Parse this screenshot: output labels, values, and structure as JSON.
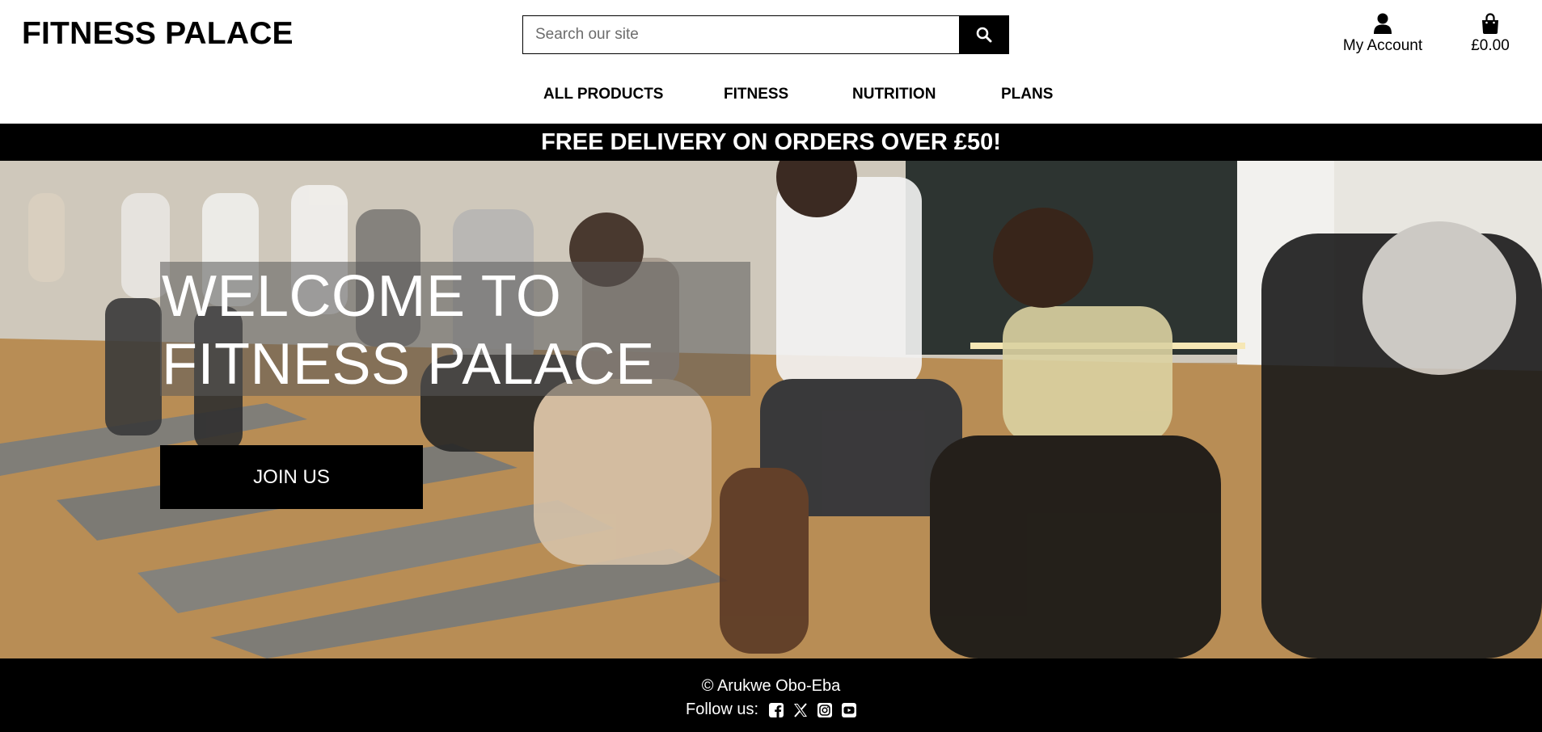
{
  "header": {
    "logo": "FITNESS PALACE",
    "search": {
      "placeholder": "Search our site",
      "button_icon": "search-icon"
    },
    "account": {
      "label": "My Account",
      "icon": "user-icon"
    },
    "bag": {
      "total": "£0.00",
      "icon": "shopping-bag-icon"
    }
  },
  "nav": {
    "items": [
      {
        "label": "ALL PRODUCTS"
      },
      {
        "label": "FITNESS"
      },
      {
        "label": "NUTRITION"
      },
      {
        "label": "PLANS"
      }
    ]
  },
  "banner": {
    "text": "FREE DELIVERY ON ORDERS OVER £50!"
  },
  "hero": {
    "title": "WELCOME TO FITNESS PALACE",
    "button_label": "JOIN US"
  },
  "footer": {
    "copyright": "© Arukwe Obo-Eba",
    "follow_label": "Follow us:",
    "social_icons": [
      "facebook-icon",
      "x-icon",
      "instagram-icon",
      "youtube-icon"
    ]
  },
  "colors": {
    "primary": "#000000",
    "background": "#ffffff",
    "text_on_dark": "#ffffff"
  }
}
